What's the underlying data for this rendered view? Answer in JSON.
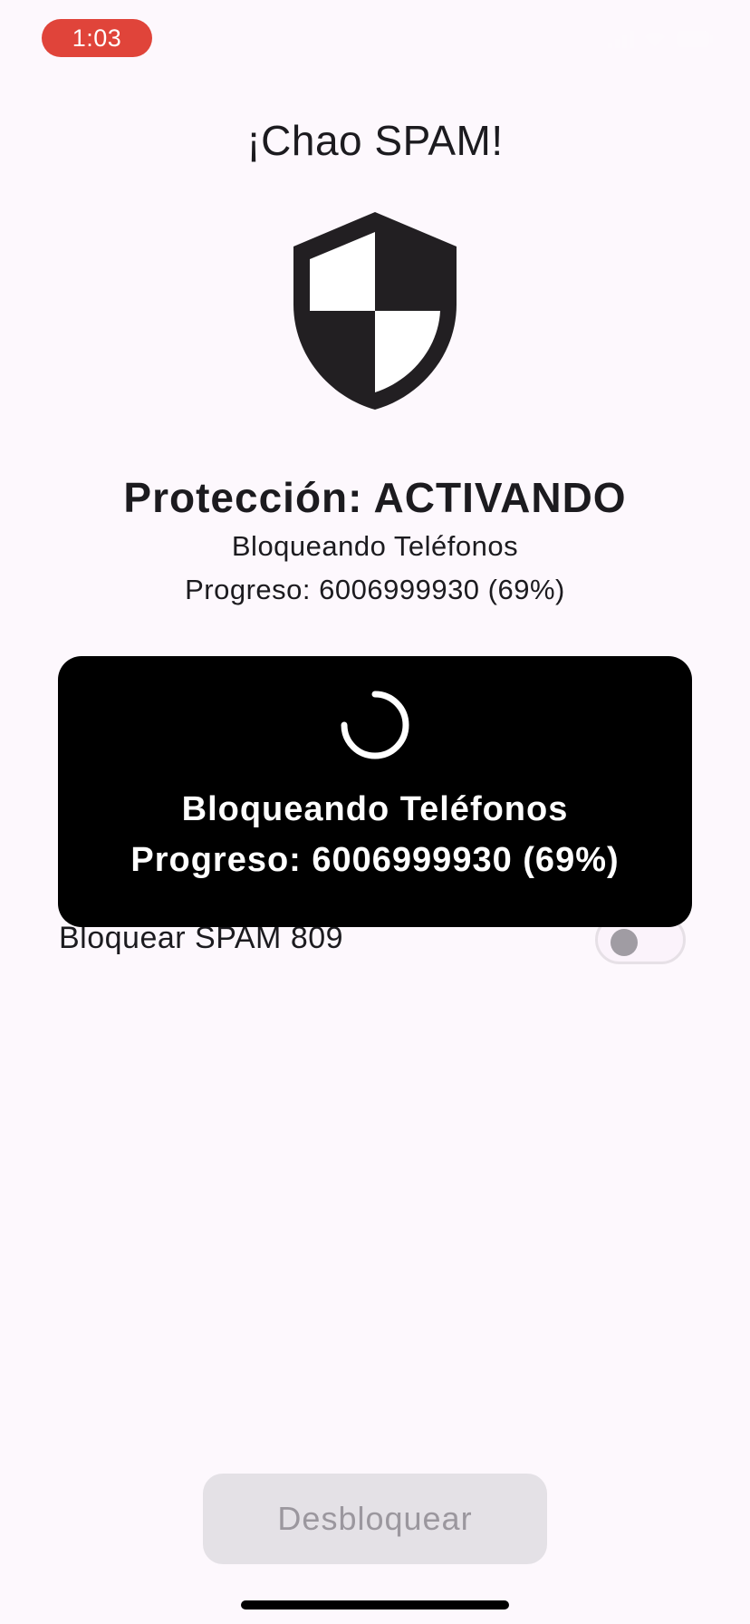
{
  "status_bar": {
    "time": "1:03",
    "time_badge_color": "#e0443a",
    "icons": [
      "signal-icon",
      "wifi-icon",
      "battery-icon"
    ]
  },
  "header": {
    "title": "¡Chao SPAM!"
  },
  "shield": {
    "icon": "shield-icon"
  },
  "protection": {
    "status": "Protección: ACTIVANDO",
    "detail_line": "Bloqueando Teléfonos",
    "progress_line": "Progreso: 6006999930 (69%)"
  },
  "overlay": {
    "icon": "spinner-icon",
    "line1": "Bloqueando Teléfonos",
    "line2": "Progreso: 6006999930 (69%)"
  },
  "settings": {
    "spam_809": {
      "label": "Bloquear SPAM 809",
      "enabled": false
    }
  },
  "footer": {
    "unlock_label": "Desbloquear"
  }
}
